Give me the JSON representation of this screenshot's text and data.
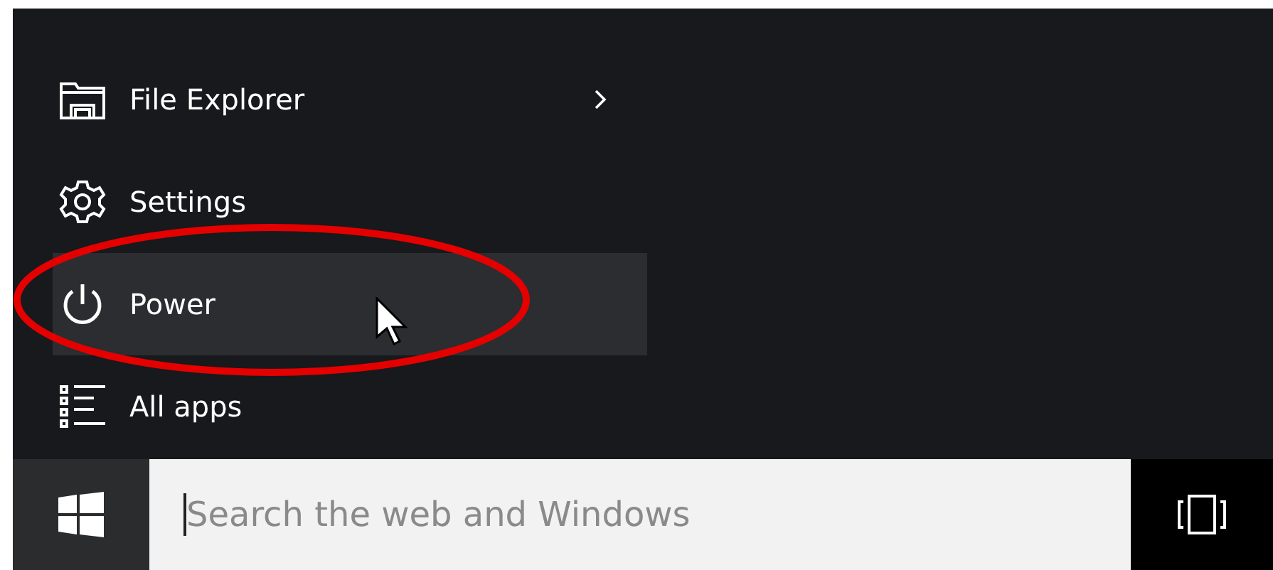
{
  "start_menu": {
    "items": [
      {
        "kind": "folder",
        "label": "File Explorer",
        "selected": false,
        "has_submenu": true
      },
      {
        "kind": "gear",
        "label": "Settings",
        "selected": false,
        "has_submenu": false
      },
      {
        "kind": "power",
        "label": "Power",
        "selected": true,
        "has_submenu": false
      },
      {
        "kind": "list",
        "label": "All apps",
        "selected": false,
        "has_submenu": false
      }
    ]
  },
  "taskbar": {
    "search": {
      "placeholder": "Search the web and Windows"
    }
  }
}
